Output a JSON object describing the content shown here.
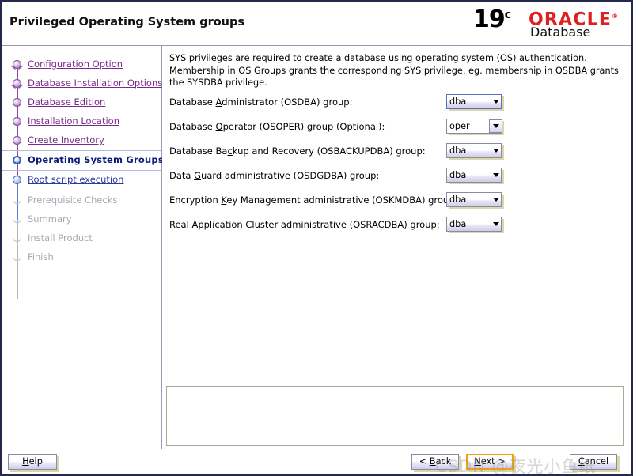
{
  "header": {
    "title": "Privileged Operating System groups",
    "logo": {
      "version": "19",
      "version_sup": "c",
      "brand": "ORACLE",
      "brand_tm": "®",
      "product": "Database"
    }
  },
  "sidebar": {
    "items": [
      {
        "label": "Configuration Option",
        "state": "done",
        "node": "branch"
      },
      {
        "label": "Database Installation Options",
        "state": "done",
        "node": "branch"
      },
      {
        "label": "Database Edition",
        "state": "done",
        "node": "ball"
      },
      {
        "label": "Installation Location",
        "state": "done",
        "node": "ball"
      },
      {
        "label": "Create Inventory",
        "state": "done",
        "node": "ball"
      },
      {
        "label": "Operating System Groups",
        "state": "current",
        "node": "current"
      },
      {
        "label": "Root script execution",
        "state": "done-blue",
        "node": "ball-blue"
      },
      {
        "label": "Prerequisite Checks",
        "state": "todo",
        "node": "hollow"
      },
      {
        "label": "Summary",
        "state": "todo",
        "node": "hollow"
      },
      {
        "label": "Install Product",
        "state": "todo",
        "node": "hollow"
      },
      {
        "label": "Finish",
        "state": "todo",
        "node": "hollow"
      }
    ]
  },
  "main": {
    "intro": "SYS privileges are required to create a database using operating system (OS) authentication. Membership in OS Groups grants the corresponding SYS privilege, eg. membership in OSDBA grants the SYSDBA privilege.",
    "fields": [
      {
        "label_pre": "Database ",
        "mnemonic": "A",
        "label_post": "dministrator (OSDBA) group:",
        "value": "dba",
        "style": "focused"
      },
      {
        "label_pre": "Database ",
        "mnemonic": "O",
        "label_post": "perator (OSOPER) group (Optional):",
        "value": "oper",
        "style": "editable"
      },
      {
        "label_pre": "Database Ba",
        "mnemonic": "c",
        "label_post": "kup and Recovery (OSBACKUPDBA) group:",
        "value": "dba",
        "style": "normal"
      },
      {
        "label_pre": "Data ",
        "mnemonic": "G",
        "label_post": "uard administrative (OSDGDBA) group:",
        "value": "dba",
        "style": "normal"
      },
      {
        "label_pre": "Encryption ",
        "mnemonic": "K",
        "label_post": "ey Management administrative (OSKMDBA) group:",
        "value": "dba",
        "style": "normal"
      },
      {
        "label_pre": "",
        "mnemonic": "R",
        "label_post": "eal Application Cluster administrative (OSRACDBA) group:",
        "value": "dba",
        "style": "normal"
      }
    ],
    "message_panel_text": ""
  },
  "footer": {
    "help": {
      "pre": "",
      "mnemonic": "H",
      "post": "elp"
    },
    "back": {
      "pre": "< ",
      "mnemonic": "B",
      "post": "ack"
    },
    "next": {
      "pre": "",
      "mnemonic": "N",
      "post": "ext >"
    },
    "cancel": {
      "pre": "",
      "mnemonic": "C",
      "post": "ancel"
    }
  },
  "watermark": {
    "text": "CSDN @夜光小鱼纸"
  },
  "colors": {
    "window_border": "#252a4a",
    "brand_red": "#e02020",
    "done_link": "#7a2a8a",
    "current_text": "#0a1f7a",
    "todo_text": "#a8a8b4",
    "focus_ring": "#f0a010"
  }
}
